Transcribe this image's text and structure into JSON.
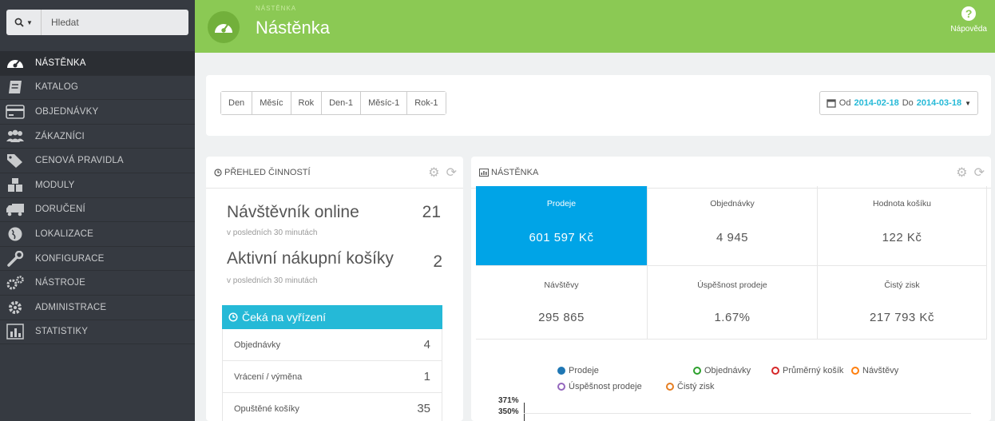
{
  "search": {
    "placeholder": "Hledat",
    "icon": "search-icon"
  },
  "sidebar": {
    "items": [
      {
        "label": "NÁSTĚNKA",
        "icon": "dashboard-icon",
        "active": true
      },
      {
        "label": "KATALOG",
        "icon": "book-icon"
      },
      {
        "label": "OBJEDNÁVKY",
        "icon": "credit-card-icon"
      },
      {
        "label": "ZÁKAZNÍCI",
        "icon": "users-icon"
      },
      {
        "label": "CENOVÁ PRAVIDLA",
        "icon": "tag-icon"
      },
      {
        "label": "MODULY",
        "icon": "puzzle-icon"
      },
      {
        "label": "DORUČENÍ",
        "icon": "truck-icon"
      },
      {
        "label": "LOKALIZACE",
        "icon": "globe-icon"
      },
      {
        "label": "KONFIGURACE",
        "icon": "wrench-icon"
      },
      {
        "label": "NÁSTROJE",
        "icon": "cogs-icon"
      },
      {
        "label": "ADMINISTRACE",
        "icon": "gear-icon"
      },
      {
        "label": "STATISTIKY",
        "icon": "bar-chart-icon"
      }
    ]
  },
  "header": {
    "breadcrumb": "NÁSTĚNKA",
    "title": "Nástěnka",
    "help_label": "Nápověda",
    "accent": "#8bc954"
  },
  "toolbar": {
    "periods": [
      "Den",
      "Měsíc",
      "Rok",
      "Den-1",
      "Měsíc-1",
      "Rok-1"
    ],
    "date_from_label": "Od",
    "date_from": "2014-02-18",
    "date_to_label": "Do",
    "date_to": "2014-03-18"
  },
  "activity": {
    "title": "PŘEHLED ČINNOSTÍ",
    "visitors_label": "Návštěvník online",
    "visitors_value": "21",
    "visitors_sub": "v posledních 30 minutách",
    "carts_label": "Aktivní nákupní košíky",
    "carts_value": "2",
    "carts_sub": "v posledních 30 minutách",
    "pending_title": "Čeká na vyřízení",
    "pending": [
      {
        "label": "Objednávky",
        "value": "4"
      },
      {
        "label": "Vrácení / výměna",
        "value": "1"
      },
      {
        "label": "Opuštěné košíky",
        "value": "35"
      }
    ]
  },
  "dashboard": {
    "title": "NÁSTĚNKA",
    "kpis": [
      {
        "label": "Prodeje",
        "value": "601 597 Kč"
      },
      {
        "label": "Objednávky",
        "value": "4 945"
      },
      {
        "label": "Hodnota košíku",
        "value": "122 Kč"
      },
      {
        "label": "Návštěvy",
        "value": "295 865"
      },
      {
        "label": "Úspěšnost prodeje",
        "value": "1.67%"
      },
      {
        "label": "Čistý zisk",
        "value": "217 793 Kč"
      }
    ],
    "legend": [
      {
        "label": "Prodeje",
        "color": "#1f77b4",
        "filled": true
      },
      {
        "label": "Objednávky",
        "color": "#2ca02c"
      },
      {
        "label": "Průměrný košík",
        "color": "#d62728"
      },
      {
        "label": "Návštěvy",
        "color": "#ff7f0e"
      },
      {
        "label": "Úspěšnost prodeje",
        "color": "#9467bd"
      },
      {
        "label": "Čistý zisk",
        "color": "#e67e22"
      }
    ],
    "y_ticks": [
      "371%",
      "350%"
    ]
  },
  "colors": {
    "sidebar": "#363a41",
    "primary": "#25b9d7",
    "kpi_selected": "#00a4e7"
  }
}
